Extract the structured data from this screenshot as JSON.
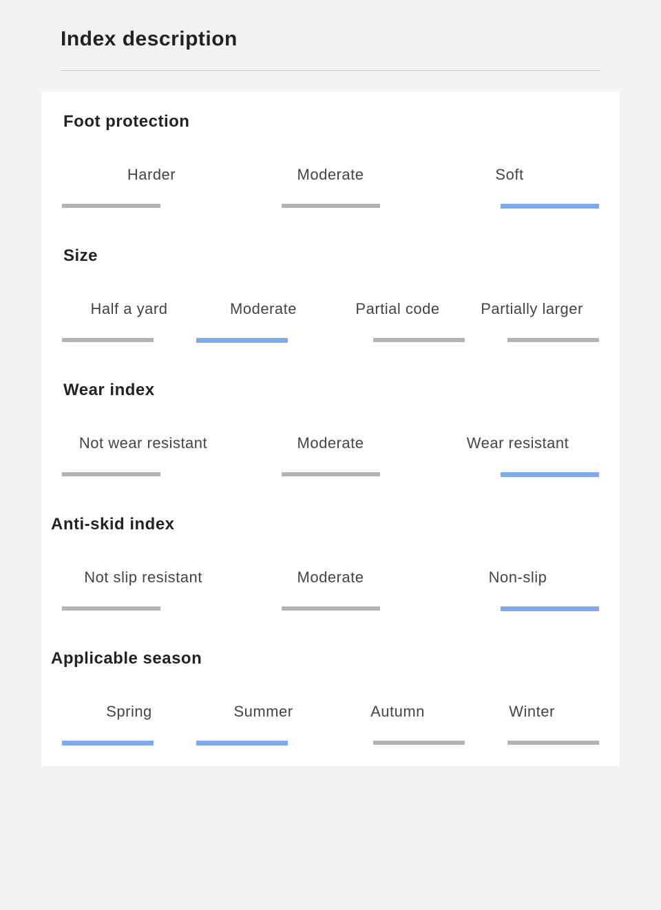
{
  "page_title": "Index description",
  "sections": [
    {
      "key": "foot_protection",
      "title": "Foot protection",
      "tight": false,
      "wide": false,
      "cols": 3,
      "options": [
        {
          "label": "Harder",
          "active": false
        },
        {
          "label": "Moderate",
          "active": false
        },
        {
          "label": "Soft",
          "active": true
        }
      ]
    },
    {
      "key": "size",
      "title": "Size",
      "tight": false,
      "wide": false,
      "cols": 4,
      "options": [
        {
          "label": "Half a yard",
          "active": false
        },
        {
          "label": "Moderate",
          "active": true
        },
        {
          "label": "Partial code",
          "active": false
        },
        {
          "label": "Partially larger",
          "active": false
        }
      ]
    },
    {
      "key": "wear_index",
      "title": "Wear index",
      "tight": false,
      "wide": true,
      "cols": 3,
      "options": [
        {
          "label": "Not wear resistant",
          "active": false
        },
        {
          "label": "Moderate",
          "active": false
        },
        {
          "label": "Wear resistant",
          "active": true
        }
      ]
    },
    {
      "key": "anti_skid",
      "title": "Anti-skid index",
      "tight": true,
      "wide": true,
      "cols": 3,
      "options": [
        {
          "label": "Not slip resistant",
          "active": false
        },
        {
          "label": "Moderate",
          "active": false
        },
        {
          "label": "Non-slip",
          "active": true
        }
      ]
    },
    {
      "key": "season",
      "title": "Applicable season",
      "tight": true,
      "wide": false,
      "cols": 4,
      "options": [
        {
          "label": "Spring",
          "active": true
        },
        {
          "label": "Summer",
          "active": true
        },
        {
          "label": "Autumn",
          "active": false
        },
        {
          "label": "Winter",
          "active": false
        }
      ]
    }
  ]
}
